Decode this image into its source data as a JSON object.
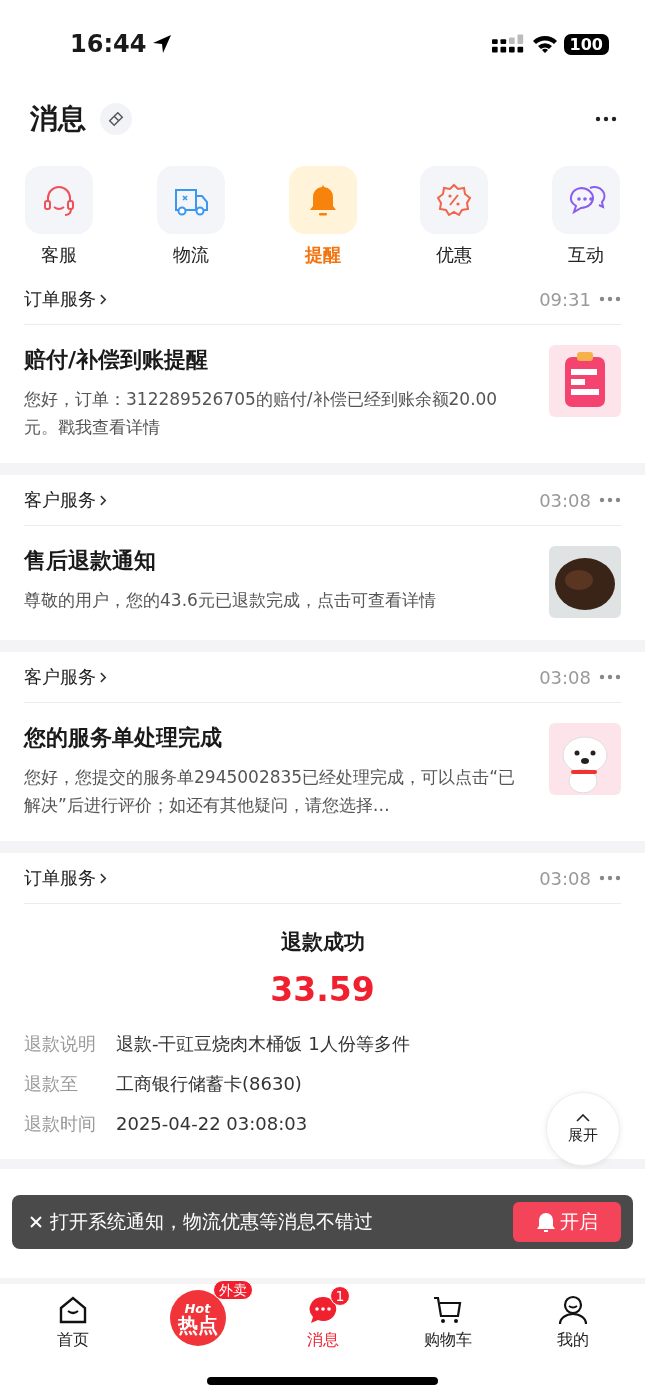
{
  "status_bar": {
    "time": "16:44",
    "battery": "100"
  },
  "header": {
    "title": "消息"
  },
  "categories": [
    {
      "label": "客服",
      "kind": "headset",
      "selected": false
    },
    {
      "label": "物流",
      "kind": "truck",
      "selected": false
    },
    {
      "label": "提醒",
      "kind": "bell",
      "selected": true
    },
    {
      "label": "优惠",
      "kind": "coupon",
      "selected": false
    },
    {
      "label": "互动",
      "kind": "chat",
      "selected": false
    }
  ],
  "messages": [
    {
      "kind": "text",
      "source": "订单服务",
      "time": "09:31",
      "title": "赔付/补偿到账提醒",
      "body": "您好，订单：312289526705的赔付/补偿已经到账余额20.00元。戳我查看详情",
      "thumb": {
        "kind": "clipboard"
      }
    },
    {
      "kind": "text",
      "source": "客户服务",
      "time": "03:08",
      "title": "售后退款通知",
      "body": "尊敬的用户，您的43.6元已退款完成，点击可查看详情",
      "thumb": {
        "kind": "photo"
      }
    },
    {
      "kind": "text",
      "source": "客户服务",
      "time": "03:08",
      "title": "您的服务单处理完成",
      "body": "您好，您提交的服务单2945002835已经处理完成，可以点击“已解决”后进行评价；如还有其他疑问，请您选择…",
      "thumb": {
        "kind": "mascot"
      }
    },
    {
      "kind": "refund",
      "source": "订单服务",
      "time": "03:08",
      "title": "退款成功",
      "amount": "33.59",
      "details": [
        {
          "label": "退款说明",
          "value": "退款-干豇豆烧肉木桶饭 1人份等多件"
        },
        {
          "label": "退款至",
          "value": "工商银行储蓄卡(8630)"
        },
        {
          "label": "退款时间",
          "value": "2025-04-22 03:08:03"
        }
      ]
    }
  ],
  "expand_button": {
    "label": "展开"
  },
  "toast": {
    "text": "打开系统通知，物流优惠等消息不错过",
    "button": "开启"
  },
  "tabs": [
    {
      "label": "首页",
      "kind": "home",
      "selected": false
    },
    {
      "label": "热点",
      "kind": "hot",
      "logo_top": "Hot",
      "badge": "外卖",
      "selected": false
    },
    {
      "label": "消息",
      "kind": "messages",
      "badge": "1",
      "selected": true
    },
    {
      "label": "购物车",
      "kind": "cart",
      "selected": false
    },
    {
      "label": "我的",
      "kind": "profile",
      "selected": false
    }
  ]
}
